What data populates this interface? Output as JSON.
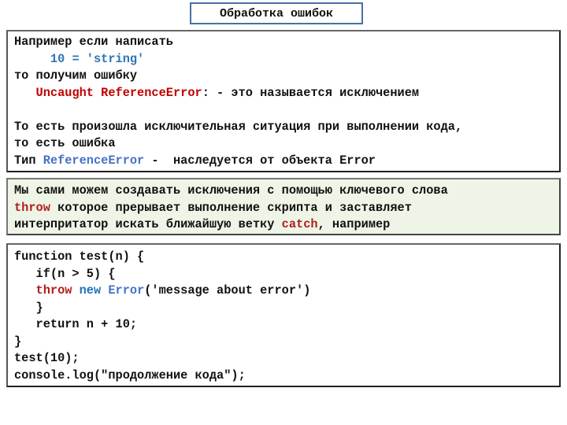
{
  "title": "Обработка ошибок",
  "box1": {
    "line1": "Например если написать",
    "line2_indent": "     ",
    "line2_code": "10 = 'string'",
    "line3": "то получим ошибку",
    "line4_indent": "   ",
    "line4_error": "Uncaught ReferenceError",
    "line4_rest": ": - это называется исключением",
    "line5": "",
    "line6": "То есть произошла исключительная ситуация при выполнении кода,",
    "line7": "то есть ошибка",
    "line8_pre": "Тип ",
    "line8_type": "ReferenceError",
    "line8_post": " -  наследуется от объекта Error"
  },
  "box2": {
    "line1": "Мы сами можем создавать исключения с помощью ключевого слова",
    "line2_kw": "throw",
    "line2_rest": " которое прерывает выполнение скрипта и заставляет",
    "line3_pre": "интерпритатор искать ближайшую ветку ",
    "line3_kw": "catch",
    "line3_post": ", например",
    "bg_color": "#eef4e6"
  },
  "code": {
    "line1": "function test(n) {",
    "line2": "   if(n > 5) {",
    "line3_indent": "   ",
    "line3_throw": "throw",
    "line3_new": " new",
    "line3_error": " Error",
    "line3_rest": "('message about error')",
    "line4": "   }",
    "line5": "   return n + 10;",
    "line6": "}",
    "line7": "test(10);",
    "line8": "console.log(\"продолжение кода\");"
  },
  "colors": {
    "title_border": "#4a6fa5",
    "error_red": "#c00000",
    "keyword_blue": "#2e75b6",
    "type_blue": "#4472c4"
  }
}
